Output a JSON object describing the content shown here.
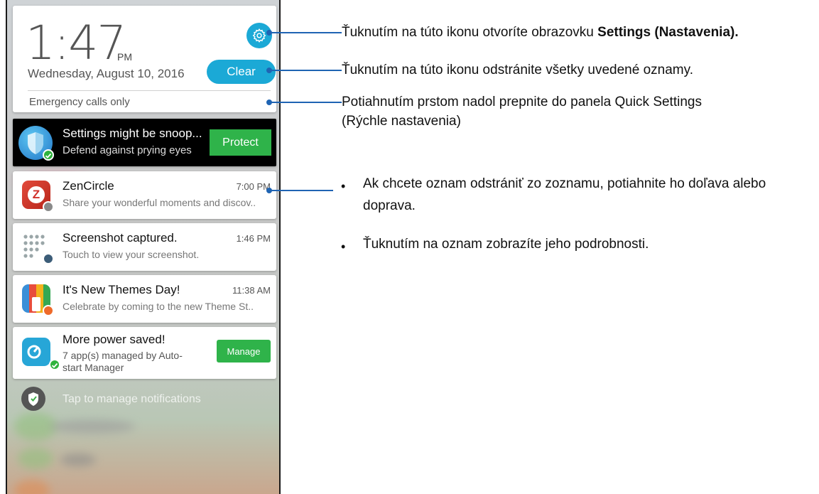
{
  "header": {
    "clock": "1:47",
    "ampm": "PM",
    "date": "Wednesday, August 10, 2016",
    "clear_label": "Clear",
    "emergency": "Emergency calls only",
    "gear_icon": "settings-gear-icon"
  },
  "security_card": {
    "title": "Settings might be snoop...",
    "subtitle": "Defend against prying eyes",
    "button": "Protect",
    "icon": "shield-icon"
  },
  "notifications": [
    {
      "title": "ZenCircle",
      "time": "7:00 PM",
      "subtitle": "Share your wonderful moments and discov..",
      "icon": "zencircle-icon"
    },
    {
      "title": "Screenshot captured.",
      "time": "1:46 PM",
      "subtitle": "Touch to view your screenshot.",
      "icon": "screenshot-icon"
    },
    {
      "title": "It's New Themes Day!",
      "time": "11:38 AM",
      "subtitle": "Celebrate by coming to the new Theme St..",
      "icon": "themes-icon"
    }
  ],
  "power_card": {
    "title": "More power saved!",
    "subtitle_line1": "7 app(s) managed by Auto-",
    "subtitle_line2": "start Manager",
    "button": "Manage",
    "icon": "power-manager-icon"
  },
  "manage_notifications": "Tap to manage notifications",
  "annotations": {
    "settings_prefix": "Ťuknutím na túto ikonu otvoríte obrazovku ",
    "settings_bold": "Settings (Nastavenia).",
    "clear": "Ťuknutím na túto ikonu odstránite všetky uvedené oznamy.",
    "quick_line1": "Potiahnutím prstom nadol prepnite do panela Quick Settings",
    "quick_line2": "(Rýchle nastavenia)",
    "bullet1_line1": "Ak chcete oznam odstrániť zo zoznamu, potiahnite ho doľava alebo",
    "bullet1_line2": "doprava.",
    "bullet2": "Ťuknutím na oznam zobrazíte jeho podrobnosti.",
    "bullet_char": "•"
  },
  "colors": {
    "accent": "#1ba9d6",
    "green": "#2fb34a",
    "leader": "#1f64b3"
  }
}
